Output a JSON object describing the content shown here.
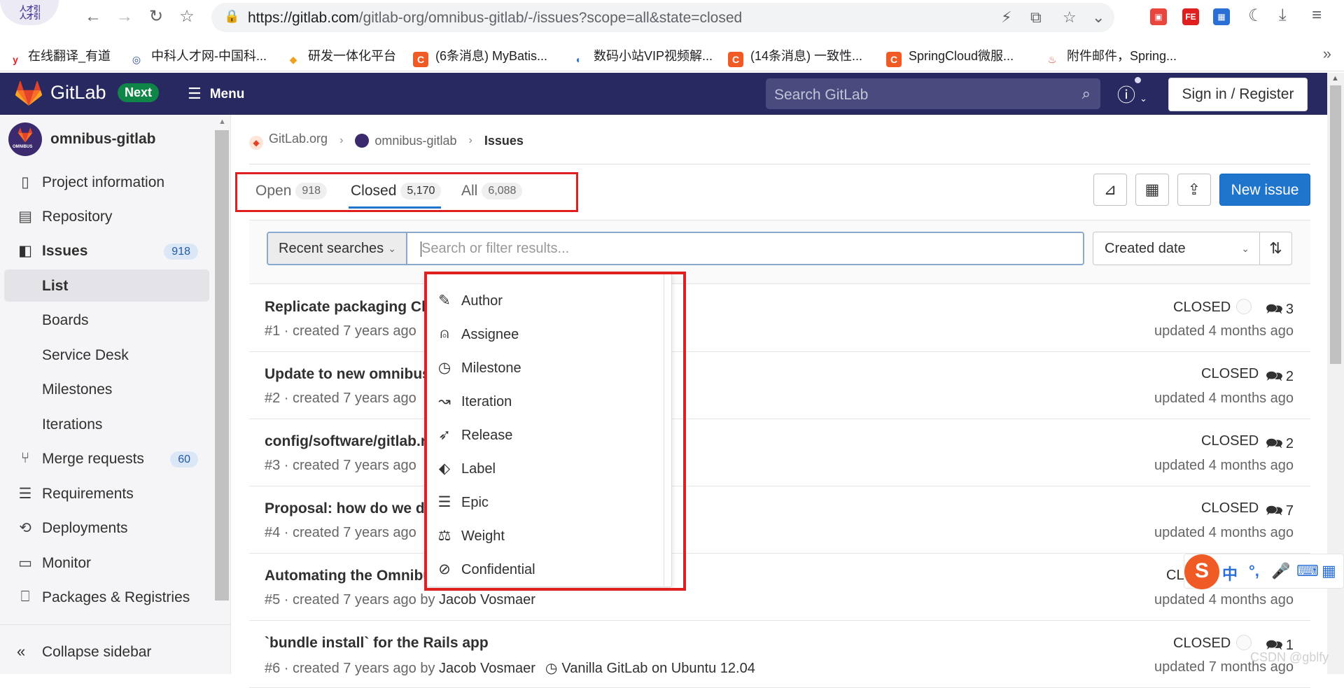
{
  "browser": {
    "url_host": "https://gitlab.com",
    "url_path": "/gitlab-org/omnibus-gitlab/-/issues?scope=all&state=closed",
    "bookmarks": [
      {
        "label": "在线翻译_有道",
        "icon_color": "#e8212a",
        "icon_text": "y"
      },
      {
        "label": "中科人才网-中国科...",
        "icon_color": "#2b4a9a",
        "icon_text": "◎"
      },
      {
        "label": "研发一体化平台",
        "icon_color": "#f0a020",
        "icon_text": "◆"
      },
      {
        "label": "(6条消息) MyBatis...",
        "icon_color": "#f05a24",
        "icon_text": "C"
      },
      {
        "label": "数码小站VIP视频解...",
        "icon_color": "#2a6fd6",
        "icon_text": "◐"
      },
      {
        "label": "(14条消息) 一致性...",
        "icon_color": "#f05a24",
        "icon_text": "C"
      },
      {
        "label": "SpringCloud微服...",
        "icon_color": "#f05a24",
        "icon_text": "C"
      },
      {
        "label": "附件邮件，Spring...",
        "icon_color": "#ffffff",
        "icon_text": "🔥"
      }
    ]
  },
  "header": {
    "brand": "GitLab",
    "next_badge": "Next",
    "menu_label": "Menu",
    "search_placeholder": "Search GitLab",
    "signin_label": "Sign in / Register",
    "colors": {
      "bar": "#292961",
      "accent": "#1f75cb",
      "next": "#108548"
    }
  },
  "sidebar": {
    "project_name": "omnibus-gitlab",
    "avatar_text": "OMNIBUS",
    "items": [
      {
        "label": "Project information",
        "icon": "info-icon"
      },
      {
        "label": "Repository",
        "icon": "doc-icon"
      },
      {
        "label": "Issues",
        "icon": "issues-icon",
        "badge": "918"
      },
      {
        "label": "List"
      },
      {
        "label": "Boards"
      },
      {
        "label": "Service Desk"
      },
      {
        "label": "Milestones"
      },
      {
        "label": "Iterations"
      },
      {
        "label": "Merge requests",
        "icon": "merge-icon",
        "badge": "60"
      },
      {
        "label": "Requirements",
        "icon": "requirements-icon"
      },
      {
        "label": "Deployments",
        "icon": "deploy-icon"
      },
      {
        "label": "Monitor",
        "icon": "monitor-icon"
      },
      {
        "label": "Packages & Registries",
        "icon": "package-icon"
      }
    ],
    "collapse_label": "Collapse sidebar"
  },
  "breadcrumb": {
    "items": [
      "GitLab.org",
      "omnibus-gitlab",
      "Issues"
    ]
  },
  "tabs": {
    "open": {
      "label": "Open",
      "count": "918"
    },
    "closed": {
      "label": "Closed",
      "count": "5,170"
    },
    "all": {
      "label": "All",
      "count": "6,088"
    }
  },
  "actions": {
    "new_issue": "New issue"
  },
  "filter": {
    "recent_searches": "Recent searches",
    "placeholder": "Search or filter results...",
    "sort": "Created date"
  },
  "dropdown": {
    "items": [
      {
        "label": "Author",
        "icon": "pencil-icon",
        "glyph": "✎"
      },
      {
        "label": "Assignee",
        "icon": "user-icon",
        "glyph": "⍝"
      },
      {
        "label": "Milestone",
        "icon": "clock-icon",
        "glyph": "◷"
      },
      {
        "label": "Iteration",
        "icon": "iteration-icon",
        "glyph": "↝"
      },
      {
        "label": "Release",
        "icon": "rocket-icon",
        "glyph": "➶"
      },
      {
        "label": "Label",
        "icon": "label-icon",
        "glyph": "⬖"
      },
      {
        "label": "Epic",
        "icon": "epic-icon",
        "glyph": "☰"
      },
      {
        "label": "Weight",
        "icon": "weight-icon",
        "glyph": "⚖"
      },
      {
        "label": "Confidential",
        "icon": "eye-slash-icon",
        "glyph": "⊘"
      }
    ]
  },
  "issues": [
    {
      "title": "Replicate packaging Ch",
      "meta": "#1 · created 7 years ago",
      "author": "",
      "milestone": "",
      "state": "CLOSED",
      "comments": "3",
      "updated": "updated 4 months ago"
    },
    {
      "title": "Update to new omnibus",
      "meta": "#2 · created 7 years ago",
      "author": "",
      "milestone": "",
      "state": "CLOSED",
      "comments": "2",
      "updated": "updated 4 months ago"
    },
    {
      "title": "config/software/gitlab.r",
      "meta": "#3 · created 7 years ago",
      "author": "",
      "milestone": "",
      "state": "CLOSED",
      "comments": "2",
      "updated": "updated 4 months ago"
    },
    {
      "title": "Proposal: how do we do",
      "meta": "#4 · created 7 years ago",
      "author": "",
      "milestone": "",
      "state": "CLOSED",
      "comments": "7",
      "updated": "updated 4 months ago"
    },
    {
      "title": "Automating the Omnibu",
      "meta": "#5 · created 7 years ago by",
      "author": "Jacob Vosmaer",
      "milestone": "",
      "state": "CL",
      "comments": "",
      "updated": "updated 4 months ago"
    },
    {
      "title": "`bundle install` for the Rails app",
      "meta": "#6 · created 7 years ago by",
      "author": "Jacob Vosmaer",
      "milestone": "Vanilla GitLab on Ubuntu 12.04",
      "state": "CLOSED",
      "comments": "1",
      "updated": "updated 7 months ago"
    }
  ],
  "ime": {
    "items": [
      "中",
      "°,",
      "🎤",
      "⌨",
      "▦"
    ]
  },
  "watermark": "CSDN @gblfy"
}
